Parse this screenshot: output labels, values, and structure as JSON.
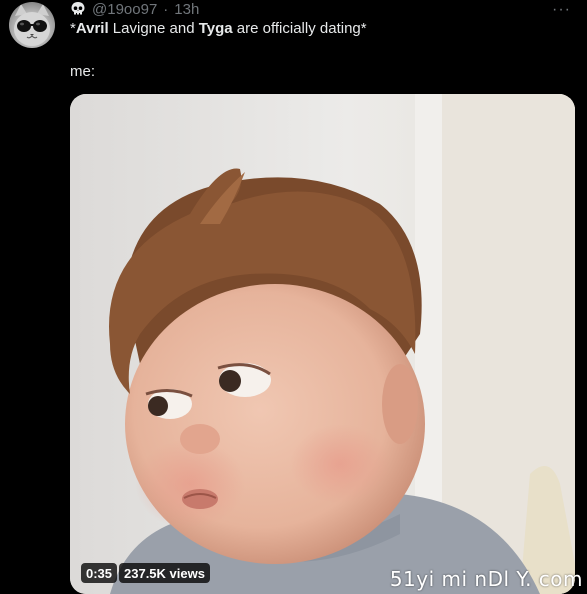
{
  "tweet": {
    "handle": "@19oo97",
    "separator": "·",
    "time": "13h",
    "more_icon": "···",
    "text_parts": [
      {
        "text": "*",
        "bold": false
      },
      {
        "text": "Avril",
        "bold": true
      },
      {
        "text": " Lavigne and ",
        "bold": false
      },
      {
        "text": "Tyga",
        "bold": true
      },
      {
        "text": " are officially dating*",
        "bold": false
      }
    ],
    "reply_line": "me:"
  },
  "media": {
    "duration": "0:35",
    "views": "237.5K views"
  },
  "watermark": "51yi mi nDl Y. com",
  "colors": {
    "background": "#000000",
    "text": "#e7e9ea",
    "muted": "#71767b"
  },
  "icons": {
    "avatar": "cat-with-sunglasses",
    "name_emoji": "skull-icon",
    "menu": "more-icon"
  }
}
